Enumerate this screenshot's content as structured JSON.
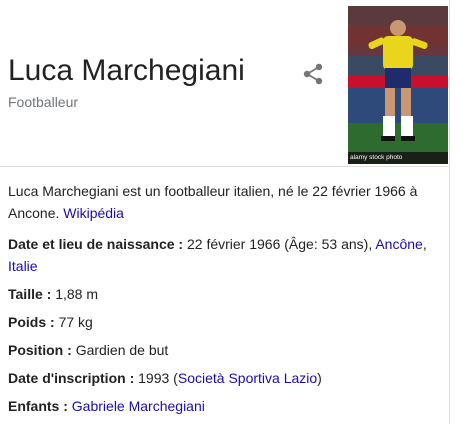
{
  "entity": {
    "title": "Luca Marchegiani",
    "subtitle": "Footballeur"
  },
  "image": {
    "watermark": "alamy stock photo"
  },
  "description": {
    "text": "Luca Marchegiani est un footballeur italien, né le 22 février 1966 à Ancone.",
    "source_link": "Wikipédia"
  },
  "facts": {
    "birth": {
      "label": "Date et lieu de naissance",
      "value_prefix": "22 février 1966 (Âge: 53 ans),",
      "link1": "Ancône",
      "link2": "Italie"
    },
    "height": {
      "label": "Taille",
      "value": "1,88 m"
    },
    "weight": {
      "label": "Poids",
      "value": "77 kg"
    },
    "position": {
      "label": "Position",
      "value": "Gardien de but"
    },
    "registration": {
      "label": "Date d'inscription",
      "value_prefix": "1993",
      "link": "Società Sportiva Lazio"
    },
    "children": {
      "label": "Enfants",
      "link": "Gabriele Marchegiani"
    }
  },
  "colors": {
    "link": "#1a0dab",
    "text": "#222222",
    "muted": "#70757a",
    "divider": "#dfe1e5"
  },
  "icons": {
    "share": "share-icon"
  }
}
